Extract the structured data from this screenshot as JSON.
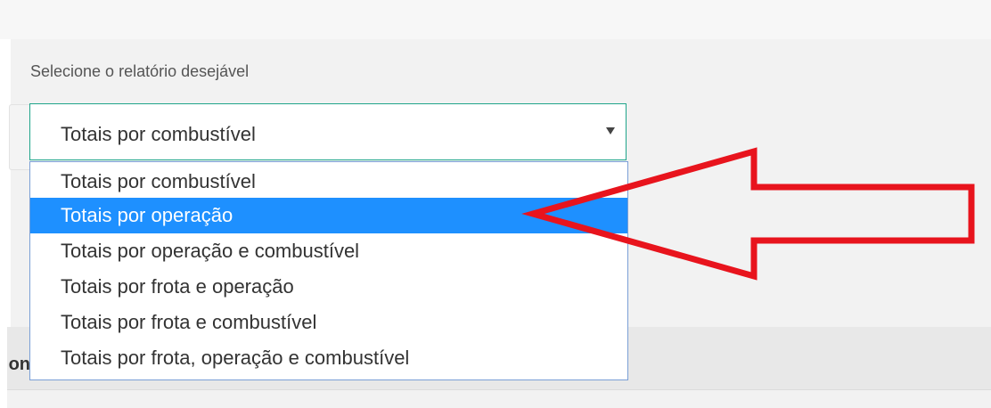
{
  "form": {
    "label": "Selecione o relatório desejável",
    "select": {
      "value": "Totais por combustível",
      "options": [
        "Totais por combustível",
        "Totais por operação",
        "Totais por operação e combustível",
        "Totais por frota e operação",
        "Totais por frota e combustível",
        "Totais por frota, operação e combustível"
      ],
      "highlighted_index": 1
    }
  },
  "section": {
    "label": "on"
  },
  "annotation": {
    "color": "#e8141d"
  },
  "colors": {
    "focus_border": "#1fa58a",
    "highlight": "#1e90ff",
    "dropdown_border": "#7a9fd6"
  }
}
